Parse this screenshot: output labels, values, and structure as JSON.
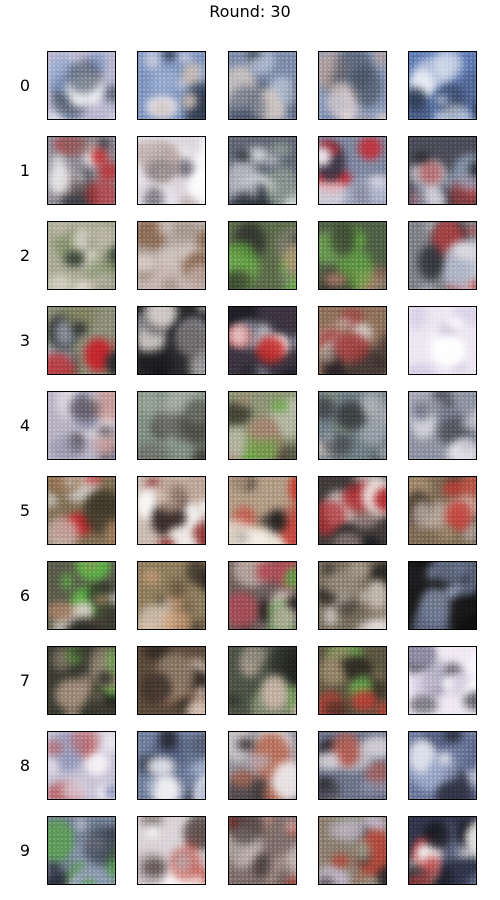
{
  "title": "Round: 30",
  "rows": [
    {
      "label": "0",
      "samples": [
        {
          "bg": "#b9b6cf",
          "colors": [
            "#ffffff",
            "#4a5566",
            "#7f95c2",
            "#e3e0ee"
          ]
        },
        {
          "bg": "#7f94bd",
          "colors": [
            "#e9e6ee",
            "#2f3a4c",
            "#9fb3d6",
            "#c8b9b0"
          ]
        },
        {
          "bg": "#7d8aa8",
          "colors": [
            "#39424f",
            "#aab6cc",
            "#d2c7c0",
            "#5a6478"
          ]
        },
        {
          "bg": "#8a98b7",
          "colors": [
            "#f2dfd9",
            "#46505f",
            "#b69f98",
            "#6f80a6"
          ]
        },
        {
          "bg": "#5f7ab2",
          "colors": [
            "#eaeef5",
            "#2a3548",
            "#a9bbd9",
            "#4b5e85"
          ]
        }
      ]
    },
    {
      "label": "1",
      "samples": [
        {
          "bg": "#8e8a95",
          "colors": [
            "#ffffff",
            "#c0282a",
            "#2a2a30",
            "#7c6a6a"
          ]
        },
        {
          "bg": "#e6e3ea",
          "colors": [
            "#ffffff",
            "#b7a6a3",
            "#6f6a74",
            "#d8d0d8"
          ]
        },
        {
          "bg": "#5f6672",
          "colors": [
            "#ffffff",
            "#222730",
            "#9fb0a1",
            "#c9c8d4"
          ]
        },
        {
          "bg": "#7d869f",
          "colors": [
            "#c32a33",
            "#f1e9ef",
            "#3a3544",
            "#aab1c9"
          ]
        },
        {
          "bg": "#4b4b57",
          "colors": [
            "#22242b",
            "#b64a4a",
            "#8ea0b8",
            "#d9d6de"
          ]
        }
      ]
    },
    {
      "label": "2",
      "samples": [
        {
          "bg": "#a8a994",
          "colors": [
            "#e3ddd3",
            "#3a443a",
            "#7b8a62",
            "#bfb8aa"
          ]
        },
        {
          "bg": "#b4a9a3",
          "colors": [
            "#d8cbc7",
            "#8a6a55",
            "#c9b7b3",
            "#9d8f84"
          ]
        },
        {
          "bg": "#5b6a4a",
          "colors": [
            "#6dbb48",
            "#2c2d2a",
            "#b88a78",
            "#7b7a6e"
          ]
        },
        {
          "bg": "#4e5e44",
          "colors": [
            "#65a846",
            "#2f2e2a",
            "#a87b6a",
            "#7a8270"
          ]
        },
        {
          "bg": "#7e7f86",
          "colors": [
            "#dcdbe3",
            "#2c2f36",
            "#c24747",
            "#aab3c5"
          ]
        }
      ]
    },
    {
      "label": "3",
      "samples": [
        {
          "bg": "#8b8c78",
          "colors": [
            "#c3242b",
            "#2a2b2e",
            "#a9b6c8",
            "#7d7f5f"
          ]
        },
        {
          "bg": "#2a2a2d",
          "colors": [
            "#d8d2cf",
            "#6f6a6b",
            "#a4a6b0",
            "#151518"
          ]
        },
        {
          "bg": "#3b3440",
          "colors": [
            "#ffffff",
            "#c12a2a",
            "#1e1e25",
            "#a7a8b7"
          ]
        },
        {
          "bg": "#8c6f5a",
          "colors": [
            "#d2c7c3",
            "#2a2326",
            "#a03a3d",
            "#b69e8f"
          ]
        },
        {
          "bg": "#ece6f1",
          "colors": [
            "#ffffff",
            "#d8d0e6",
            "#ece6f1",
            "#c8c0d8"
          ]
        }
      ]
    },
    {
      "label": "4",
      "samples": [
        {
          "bg": "#b7b2c3",
          "colors": [
            "#ede5ea",
            "#4a4248",
            "#8a8aa3",
            "#c89a97"
          ]
        },
        {
          "bg": "#7f8d82",
          "colors": [
            "#3d3b36",
            "#aab0a7",
            "#6a6a66",
            "#9eaa9c"
          ]
        },
        {
          "bg": "#8b9174",
          "colors": [
            "#65a743",
            "#a38270",
            "#3a3a2e",
            "#c2c3b3"
          ]
        },
        {
          "bg": "#6e7b83",
          "colors": [
            "#3a3d40",
            "#a0a8b2",
            "#7e8c7c",
            "#c2bbb8"
          ]
        },
        {
          "bg": "#8e91a0",
          "colors": [
            "#eceaf0",
            "#44474f",
            "#b8b5c4",
            "#6e7185"
          ]
        }
      ]
    },
    {
      "label": "5",
      "samples": [
        {
          "bg": "#7e6d55",
          "colors": [
            "#c0272b",
            "#c9c4bd",
            "#3b3527",
            "#a57e5c"
          ]
        },
        {
          "bg": "#c9bab0",
          "colors": [
            "#ffffff",
            "#8a2c2c",
            "#3a2d2b",
            "#b79a8a"
          ]
        },
        {
          "bg": "#b09a83",
          "colors": [
            "#f5efe6",
            "#1e1d1d",
            "#c8362f",
            "#9a8370"
          ]
        },
        {
          "bg": "#403b3a",
          "colors": [
            "#f1e8e5",
            "#b22d32",
            "#1b1b1f",
            "#8f7d7a"
          ]
        },
        {
          "bg": "#7c6a55",
          "colors": [
            "#d7c8c2",
            "#c33c36",
            "#3a3128",
            "#a48a6f"
          ]
        }
      ]
    },
    {
      "label": "6",
      "samples": [
        {
          "bg": "#5a5a4b",
          "colors": [
            "#2c2b26",
            "#a07d63",
            "#5db047",
            "#d2cac2"
          ]
        },
        {
          "bg": "#8b7a5c",
          "colors": [
            "#2b2620",
            "#c99b76",
            "#e3d5c9",
            "#6a5a44"
          ]
        },
        {
          "bg": "#6a5c5a",
          "colors": [
            "#2a2222",
            "#b04a56",
            "#58a64a",
            "#c8b5ad"
          ]
        },
        {
          "bg": "#756b5c",
          "colors": [
            "#ebe5e3",
            "#2e2a26",
            "#a09486",
            "#c2b7ae"
          ]
        },
        {
          "bg": "#1a1a1b",
          "colors": [
            "#0b0b0c",
            "#6b7590",
            "#9aa6c2",
            "#202124"
          ]
        }
      ]
    },
    {
      "label": "7",
      "samples": [
        {
          "bg": "#3a3a31",
          "colors": [
            "#1f1f1c",
            "#c0a591",
            "#6aa24b",
            "#8a7f6e"
          ]
        },
        {
          "bg": "#5a4a3a",
          "colors": [
            "#e8d4c8",
            "#2b2520",
            "#c98c77",
            "#8e7b6a"
          ]
        },
        {
          "bg": "#4c5246",
          "colors": [
            "#1f201d",
            "#c7b1a5",
            "#5c9947",
            "#8b8779"
          ]
        },
        {
          "bg": "#5a5440",
          "colors": [
            "#bb3d35",
            "#2d2a22",
            "#63a04a",
            "#968569"
          ]
        },
        {
          "bg": "#efe8f3",
          "colors": [
            "#ffffff",
            "#3b3a44",
            "#d5cde0",
            "#8f8ca5"
          ]
        }
      ]
    },
    {
      "label": "8",
      "samples": [
        {
          "bg": "#c4bfd2",
          "colors": [
            "#f5f1f7",
            "#b55a5d",
            "#8f95b8",
            "#e3dde9"
          ]
        },
        {
          "bg": "#6f7c9a",
          "colors": [
            "#f2f1f5",
            "#262a36",
            "#a5b4cf",
            "#55607d"
          ]
        },
        {
          "bg": "#8f8c95",
          "colors": [
            "#ede8ea",
            "#3b3232",
            "#b56a54",
            "#b9b4c2"
          ]
        },
        {
          "bg": "#6c7287",
          "colors": [
            "#2d2a30",
            "#d7d2d8",
            "#b05a50",
            "#8b93ad"
          ]
        },
        {
          "bg": "#6b7699",
          "colors": [
            "#e3e5ee",
            "#2e3242",
            "#9aa6c7",
            "#545f82"
          ]
        }
      ]
    },
    {
      "label": "9",
      "samples": [
        {
          "bg": "#6e7a8f",
          "colors": [
            "#5aa14c",
            "#2a2e38",
            "#c8cbd8",
            "#8e9ab5"
          ]
        },
        {
          "bg": "#d9d2d6",
          "colors": [
            "#ffffff",
            "#5a4c4a",
            "#b9483e",
            "#b6aab0"
          ]
        },
        {
          "bg": "#7d6d6a",
          "colors": [
            "#c1433a",
            "#2b2425",
            "#d7cbc6",
            "#9f8a84"
          ]
        },
        {
          "bg": "#8a7d6f",
          "colors": [
            "#bfb4c6",
            "#2a262a",
            "#b0473a",
            "#8e9b8a"
          ]
        },
        {
          "bg": "#30354a",
          "colors": [
            "#f3f0f0",
            "#121318",
            "#b93b3b",
            "#6b7391"
          ]
        }
      ]
    }
  ]
}
